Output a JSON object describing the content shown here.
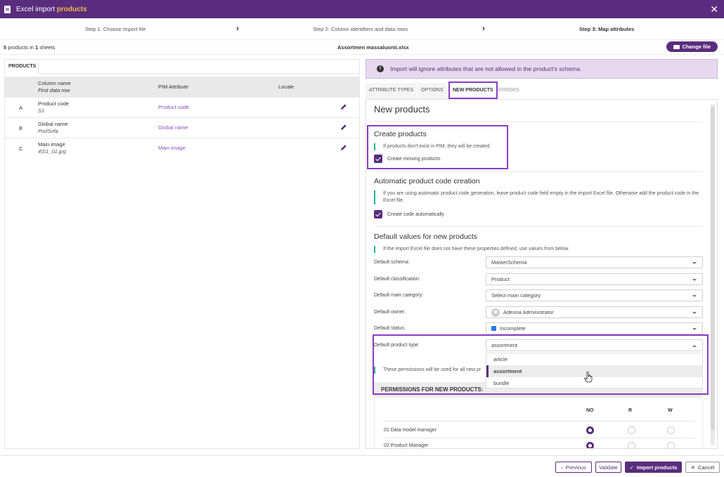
{
  "window": {
    "title_prefix": "Excel import ",
    "title_highlight": "products",
    "close_icon": "close-icon"
  },
  "steps": {
    "step1": "Step 1: Choose import file",
    "step2": "Step 2: Column identifiers and data rows",
    "step3": "Step 3: Map attributes"
  },
  "info": {
    "products_count": "5",
    "products_text": " products in ",
    "sheets_count": "1",
    "sheets_text": " sheets",
    "filename": "Assortmen massaluonti.xlsx",
    "change_file_label": "Change file"
  },
  "mapping": {
    "tab_label": "PRODUCTS",
    "headers": {
      "column_name": "Column name",
      "first_data_row": "First data row",
      "pim_attribute": "PIM Attribute",
      "locale": "Locale"
    },
    "rows": [
      {
        "key": "A",
        "name": "Product code",
        "sample": "S1",
        "attribute": "Product code"
      },
      {
        "key": "B",
        "name": "Global name",
        "sample": "PodSofa",
        "attribute": "Global name"
      },
      {
        "key": "C",
        "name": "Main image",
        "sample": "4|S1_01.jpg",
        "attribute": "Main image"
      }
    ]
  },
  "notice": {
    "text": "Import will ignore attributes that are not allowed in the product's schema."
  },
  "tabs": [
    "ATTRIBUTE TYPES",
    "OPTIONS",
    "NEW PRODUCTS",
    "ERRORS"
  ],
  "new_products": {
    "heading": "New products",
    "create": {
      "title": "Create products",
      "hint": "If products don't exist in PIM, they will be created.",
      "checkbox_label": "Create missing products"
    },
    "auto_code": {
      "title": "Automatic product code creation",
      "hint": "If you are using automatic product code generation, leave product code field empty in the import Excel file. Otherwise add the product code in the Excel file.",
      "checkbox_label": "Create code automatically"
    },
    "defaults": {
      "title": "Default values for new products",
      "hint": "If the import Excel file does not have these properties defined, use values from below.",
      "fields": [
        {
          "label": "Default schema:",
          "value": "MasterSchema"
        },
        {
          "label": "Default classification:",
          "value": "Product"
        },
        {
          "label": "Default main category:",
          "value": "Select main category"
        },
        {
          "label": "Default owner:",
          "value": "Adeona Administrator"
        },
        {
          "label": "Default status:",
          "value": "Incomplete"
        },
        {
          "label": "Default product type:",
          "value": "assortment"
        }
      ],
      "status_color": "#2f7be5",
      "product_type_options": [
        "article",
        "assortment",
        "bundle"
      ]
    },
    "permissions": {
      "hint": "These permissions will be used for all new pr",
      "title": "PERMISSIONS FOR NEW PRODUCTS:",
      "columns": [
        "NO",
        "R",
        "W"
      ],
      "rows": [
        {
          "name": "01 Data model manager",
          "selected": "NO"
        },
        {
          "name": "02 Product Manager",
          "selected": "NO"
        }
      ]
    }
  },
  "footer": {
    "previous": "Previous",
    "validate": "Validate",
    "import": "Import products",
    "cancel": "Cancel"
  },
  "colors": {
    "brand": "#5a2c7e",
    "highlight": "#8a3cc8",
    "accent_line": "#1db39a",
    "title_highlight": "#f2b84b"
  }
}
